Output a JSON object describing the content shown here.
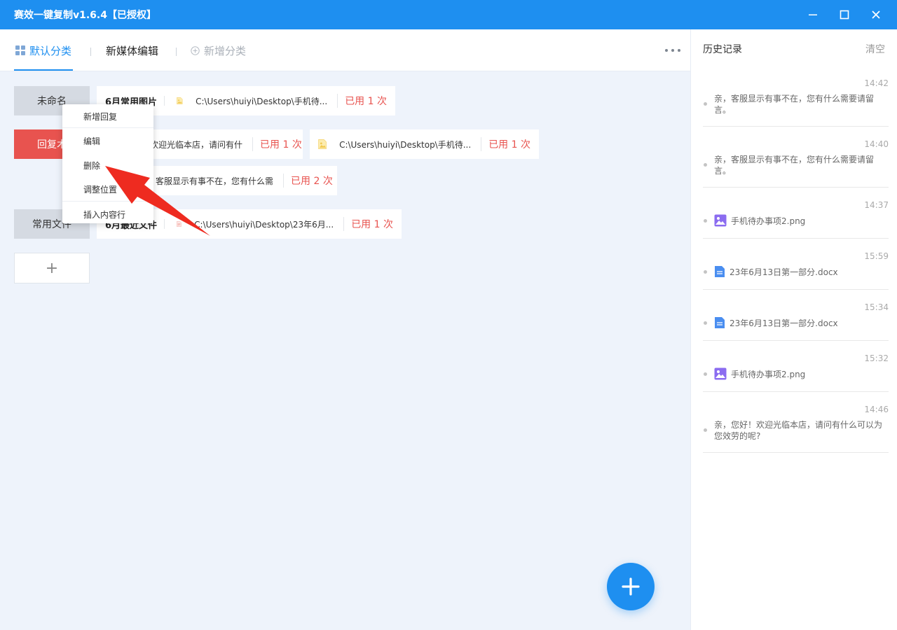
{
  "window": {
    "title": "赛效一键复制v1.6.4【已授权】"
  },
  "tabs": {
    "default": "默认分类",
    "media": "新媒体编辑",
    "add": "新增分类"
  },
  "categories": [
    {
      "label": "未命名",
      "color": "#d5dae2"
    },
    {
      "label": "回复术",
      "color": "#e8534f"
    },
    {
      "label": "常用文件",
      "color": "#d5dae2"
    },
    {
      "label": "+"
    }
  ],
  "cards": {
    "c1": {
      "name": "6月常用图片",
      "path": "C:\\Users\\huiyi\\Desktop\\手机待...",
      "used": "已用 1 次"
    },
    "c2": {
      "text": "欢迎光临本店，请问有什",
      "used": "已用 1 次"
    },
    "c3": {
      "path": "C:\\Users\\huiyi\\Desktop\\手机待...",
      "used": "已用 1 次"
    },
    "c4": {
      "text": "客服显示有事不在，您有什么需",
      "used": "已用 2 次"
    },
    "c5": {
      "name": "6月最近文件",
      "path": "C:\\Users\\huiyi\\Desktop\\23年6月...",
      "used": "已用 1 次"
    }
  },
  "context_menu": {
    "items": [
      "新增回复",
      "编辑",
      "删除",
      "调整位置",
      "插入内容行"
    ]
  },
  "history": {
    "title": "历史记录",
    "clear": "清空",
    "items": [
      {
        "time": "14:42",
        "text": "亲，客服显示有事不在，您有什么需要请留言。"
      },
      {
        "time": "14:40",
        "text": "亲，客服显示有事不在，您有什么需要请留言。"
      },
      {
        "time": "14:37",
        "file": "手机待办事项2.png",
        "icon": "image-file-icon"
      },
      {
        "time": "15:59",
        "file": "23年6月13日第一部分.docx",
        "icon": "doc-file-icon"
      },
      {
        "time": "15:34",
        "file": "23年6月13日第一部分.docx",
        "icon": "doc-file-icon"
      },
      {
        "time": "15:32",
        "file": "手机待办事项2.png",
        "icon": "image-file-icon"
      },
      {
        "time": "14:46",
        "text": "亲，您好！欢迎光临本店，请问有什么可以为您效劳的呢?"
      }
    ]
  },
  "colors": {
    "accent": "#1e8ff0",
    "danger": "#e8534f",
    "panel": "#eef3fb"
  }
}
